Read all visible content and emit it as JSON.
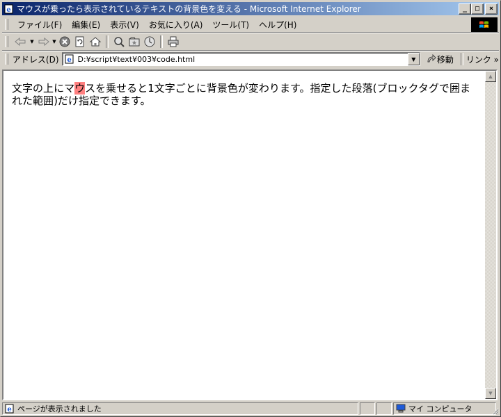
{
  "window": {
    "title": "マウスが乗ったら表示されているテキストの背景色を変える - Microsoft Internet Explorer",
    "minimize": "_",
    "maximize": "□",
    "close": "×"
  },
  "menu": {
    "items": [
      {
        "label": "ファイル(F)"
      },
      {
        "label": "編集(E)"
      },
      {
        "label": "表示(V)"
      },
      {
        "label": "お気に入り(A)"
      },
      {
        "label": "ツール(T)"
      },
      {
        "label": "ヘルプ(H)"
      }
    ]
  },
  "toolbar": {
    "icons": [
      "back-icon",
      "forward-icon",
      "stop-icon",
      "refresh-icon",
      "home-icon",
      "search-icon",
      "favorites-icon",
      "history-icon",
      "print-icon"
    ]
  },
  "address": {
    "label": "アドレス(D)",
    "url": "D:¥script¥text¥003¥code.html",
    "go_label": "移動",
    "links_label": "リンク »"
  },
  "content": {
    "text": "文字の上にマウスを乗せると1文字ごとに背景色が変わります。指定した段落(ブロックタグで囲まれた範囲)だけ指定できます。",
    "highlight_index": 6,
    "highlight_color": "#ff8080"
  },
  "status": {
    "text": "ページが表示されました",
    "zone": "マイ コンピュータ"
  }
}
